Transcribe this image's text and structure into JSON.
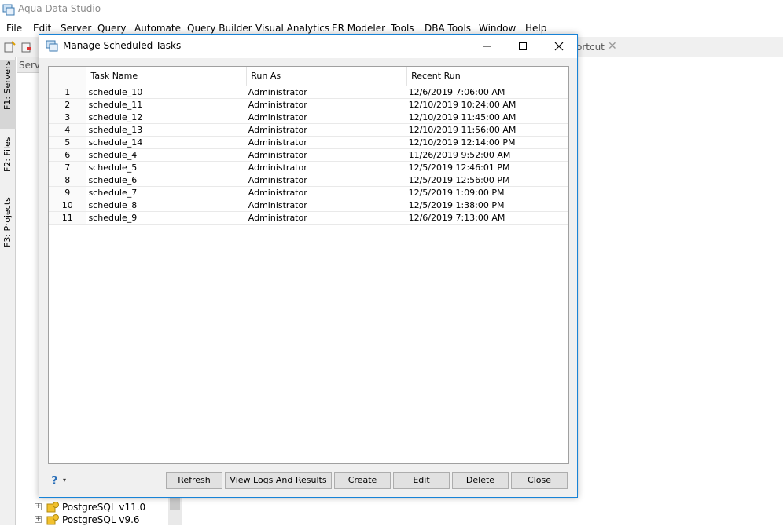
{
  "app": {
    "title": "Aqua Data Studio",
    "menu": [
      "File",
      "Edit",
      "Server",
      "Query",
      "Automate",
      "Query Builder",
      "Visual Analytics",
      "ER Modeler",
      "Tools",
      "DBA Tools",
      "Window",
      "Help"
    ],
    "background_tab_label": "ortcut",
    "sidebar_tabs": [
      "F1: Servers",
      "F2: Files",
      "F3: Projects"
    ],
    "tree_header": "Serv",
    "tree_nodes": [
      "PostgreSQL v11.0",
      "PostgreSQL v9.6"
    ]
  },
  "dialog": {
    "title": "Manage Scheduled Tasks",
    "columns": [
      "Task Name",
      "Run As",
      "Recent Run"
    ],
    "rows": [
      {
        "num": "1",
        "task": "schedule_10",
        "run_as": "Administrator",
        "recent": "12/6/2019 7:06:00 AM"
      },
      {
        "num": "2",
        "task": "schedule_11",
        "run_as": "Administrator",
        "recent": "12/10/2019 10:24:00 AM"
      },
      {
        "num": "3",
        "task": "schedule_12",
        "run_as": "Administrator",
        "recent": "12/10/2019 11:45:00 AM"
      },
      {
        "num": "4",
        "task": "schedule_13",
        "run_as": "Administrator",
        "recent": "12/10/2019 11:56:00 AM"
      },
      {
        "num": "5",
        "task": "schedule_14",
        "run_as": "Administrator",
        "recent": "12/10/2019 12:14:00 PM"
      },
      {
        "num": "6",
        "task": "schedule_4",
        "run_as": "Administrator",
        "recent": "11/26/2019 9:52:00 AM"
      },
      {
        "num": "7",
        "task": "schedule_5",
        "run_as": "Administrator",
        "recent": "12/5/2019 12:46:01 PM"
      },
      {
        "num": "8",
        "task": "schedule_6",
        "run_as": "Administrator",
        "recent": "12/5/2019 12:56:00 PM"
      },
      {
        "num": "9",
        "task": "schedule_7",
        "run_as": "Administrator",
        "recent": "12/5/2019 1:09:00 PM"
      },
      {
        "num": "10",
        "task": "schedule_8",
        "run_as": "Administrator",
        "recent": "12/5/2019 1:38:00 PM"
      },
      {
        "num": "11",
        "task": "schedule_9",
        "run_as": "Administrator",
        "recent": "12/6/2019 7:13:00 AM"
      }
    ],
    "buttons": {
      "refresh": "Refresh",
      "view_logs": "View Logs And Results",
      "create": "Create",
      "edit": "Edit",
      "delete": "Delete",
      "close": "Close"
    },
    "help_symbol": "?",
    "help_arrow": "▾"
  },
  "colors": {
    "dialog_border": "#1883d7",
    "dialog_bg": "#f0f0f0",
    "button_bg": "#e1e1e1",
    "help_icon": "#2a6fb8"
  },
  "icons": {
    "app": "database-server-icon",
    "dialog": "database-server-icon",
    "minimize": "minimize-icon",
    "maximize": "maximize-icon",
    "close": "close-icon",
    "help": "help-icon"
  }
}
